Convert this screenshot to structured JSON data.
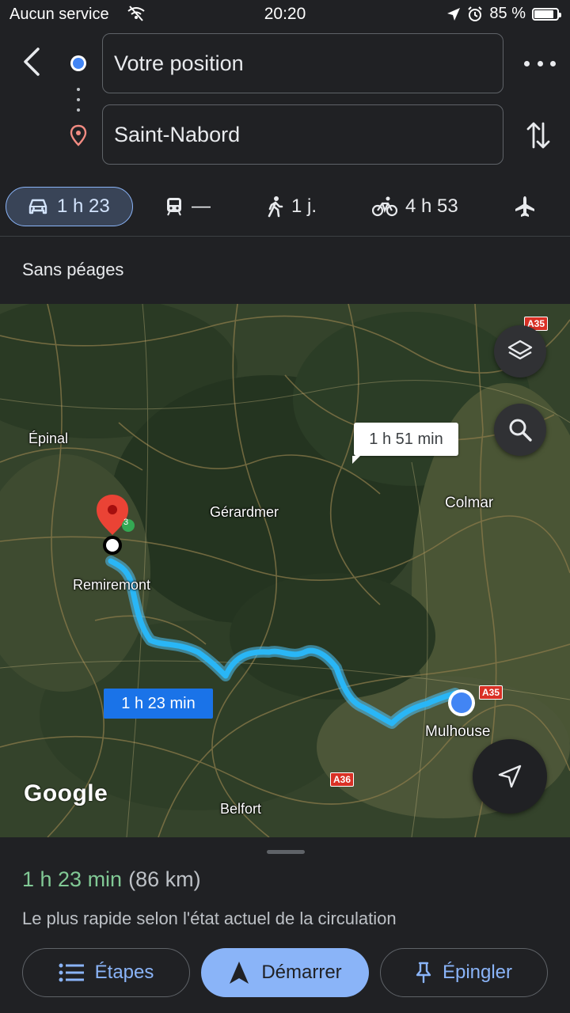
{
  "status_bar": {
    "carrier": "Aucun service",
    "time": "20:20",
    "battery": "85 %",
    "battery_level": 0.85
  },
  "directions": {
    "origin": "Votre position",
    "destination": "Saint-Nabord"
  },
  "modes": [
    {
      "name": "car",
      "icon": "car-icon",
      "label": "1 h 23",
      "selected": true
    },
    {
      "name": "transit",
      "icon": "train-icon",
      "label": "—"
    },
    {
      "name": "walk",
      "icon": "walk-icon",
      "label": "1 j."
    },
    {
      "name": "bike",
      "icon": "bike-icon",
      "label": "4 h 53"
    },
    {
      "name": "flight",
      "icon": "plane-icon",
      "label": ""
    }
  ],
  "options": {
    "label": "Sans péages"
  },
  "map": {
    "places": [
      "Épinal",
      "Gérardmer",
      "Colmar",
      "Remiremont",
      "Mulhouse",
      "Belfort"
    ],
    "road_shields": [
      "A35",
      "A35",
      "A36"
    ],
    "route_label_primary": "1 h 23 min",
    "route_label_alt": "1 h 51 min",
    "pin_badge": "3",
    "logo": "Google",
    "colors": {
      "route": "#1a73e8",
      "route_glow": "#4fc3f7",
      "pin": "#ea4335"
    }
  },
  "summary": {
    "duration": "1 h 23 min",
    "distance": "(86 km)",
    "subtitle": "Le plus rapide selon l'état actuel de la circulation"
  },
  "actions": {
    "steps": "Étapes",
    "start": "Démarrer",
    "pin": "Épingler"
  },
  "accent_colors": {
    "primary": "#8ab4f8",
    "duration_green": "#81c995"
  }
}
